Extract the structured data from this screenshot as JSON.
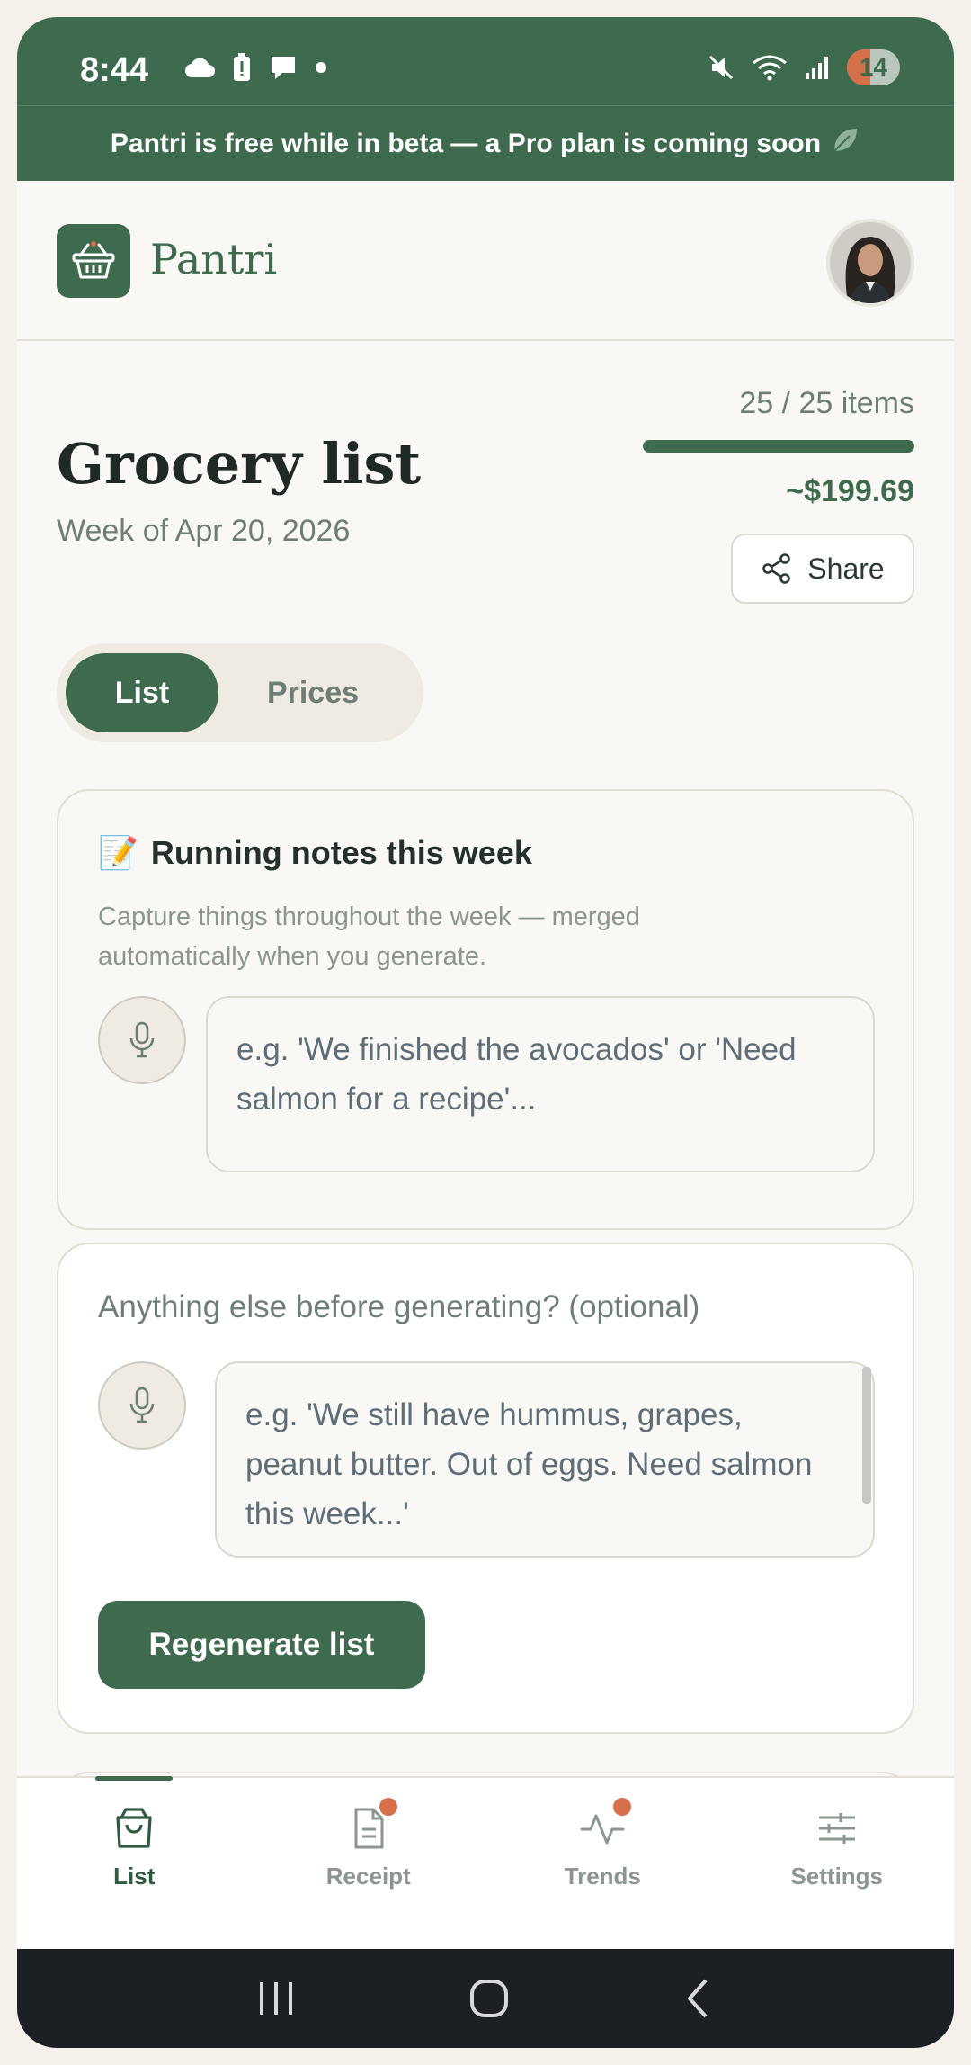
{
  "status_bar": {
    "time": "8:44",
    "battery": "14",
    "icons": [
      "cloud-icon",
      "battery-alert-icon",
      "chat-icon",
      "dot-icon",
      "mute-icon",
      "wifi-icon",
      "signal-icon"
    ]
  },
  "banner": {
    "text": "Pantri is free while in beta — a Pro plan is coming soon",
    "icon": "leaf-icon"
  },
  "header": {
    "brand": "Pantri",
    "logo_icon": "basket-icon"
  },
  "page": {
    "title": "Grocery list",
    "week": "Week of Apr 20, 2026",
    "items_count": "25 / 25 items",
    "progress_fraction": 1.0,
    "total": "~$199.69",
    "share_label": "Share"
  },
  "tabs": {
    "list": "List",
    "prices": "Prices",
    "active": "List"
  },
  "notes_card": {
    "emoji": "📝",
    "title": "Running notes this week",
    "description": "Capture things throughout the week — merged automatically when you generate.",
    "placeholder": "e.g. 'We finished the avocados' or 'Need salmon for a recipe'..."
  },
  "extra_card": {
    "label": "Anything else before generating? (optional)",
    "placeholder": "e.g. 'We still have hummus, grapes, peanut butter. Out of eggs. Need salmon this week...'",
    "button": "Regenerate list"
  },
  "bottom_nav": {
    "items": [
      {
        "label": "List",
        "icon": "bag-icon",
        "active": true,
        "badge": false
      },
      {
        "label": "Receipt",
        "icon": "receipt-icon",
        "active": false,
        "badge": true
      },
      {
        "label": "Trends",
        "icon": "activity-icon",
        "active": false,
        "badge": true
      },
      {
        "label": "Settings",
        "icon": "sliders-icon",
        "active": false,
        "badge": false
      }
    ]
  },
  "colors": {
    "brand": "#3e6b4e",
    "badge": "#d6704a",
    "background": "#faf8f4"
  }
}
